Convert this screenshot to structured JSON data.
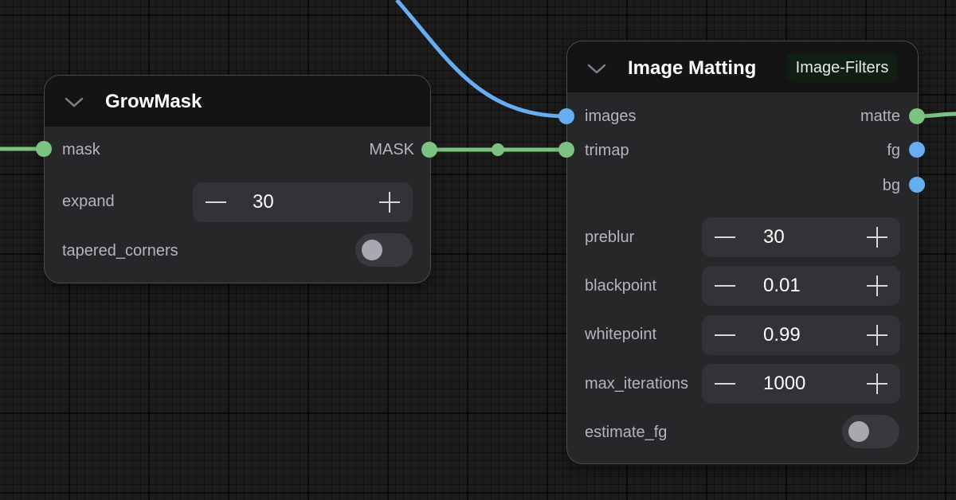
{
  "colors": {
    "mask_link": "#7cc281",
    "image_link": "#66aef0",
    "node_bg": "#262729",
    "header_bg": "#141414"
  },
  "grow_mask": {
    "title": "GrowMask",
    "inputs": [
      {
        "label": "mask",
        "type": "MASK"
      }
    ],
    "outputs": [
      {
        "label": "MASK",
        "type": "MASK"
      }
    ],
    "widgets": {
      "expand": {
        "label": "expand",
        "value": "30"
      },
      "tapered_corners": {
        "label": "tapered_corners",
        "on": false
      }
    }
  },
  "image_matting": {
    "title": "Image Matting",
    "badge": "Image-Filters",
    "inputs": [
      {
        "label": "images",
        "type": "IMAGE"
      },
      {
        "label": "trimap",
        "type": "MASK"
      }
    ],
    "outputs": [
      {
        "label": "matte",
        "type": "MASK"
      },
      {
        "label": "fg",
        "type": "IMAGE"
      },
      {
        "label": "bg",
        "type": "IMAGE"
      }
    ],
    "widgets": {
      "preblur": {
        "label": "preblur",
        "value": "30"
      },
      "blackpoint": {
        "label": "blackpoint",
        "value": "0.01"
      },
      "whitepoint": {
        "label": "whitepoint",
        "value": "0.99"
      },
      "max_iterations": {
        "label": "max_iterations",
        "value": "1000"
      },
      "estimate_fg": {
        "label": "estimate_fg",
        "on": false
      }
    }
  }
}
